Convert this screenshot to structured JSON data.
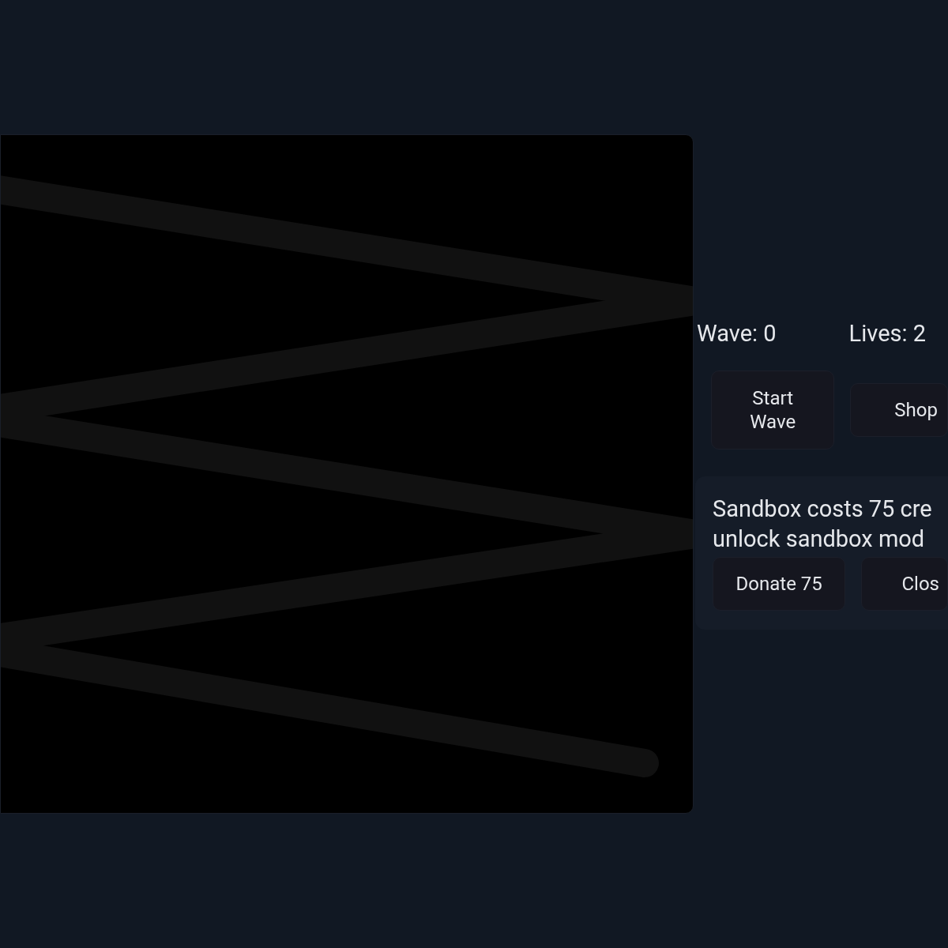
{
  "stats": [
    {
      "text": "Wave: 0"
    },
    {
      "text": "Lives: 2"
    }
  ],
  "controls": [
    {
      "label": "Start Wave"
    },
    {
      "label": "Shop"
    }
  ],
  "sandbox": {
    "message": "Sandbox costs 75 cre unlock sandbox mod",
    "buttons": [
      {
        "label": "Donate 75"
      },
      {
        "label": "Clos"
      }
    ]
  }
}
